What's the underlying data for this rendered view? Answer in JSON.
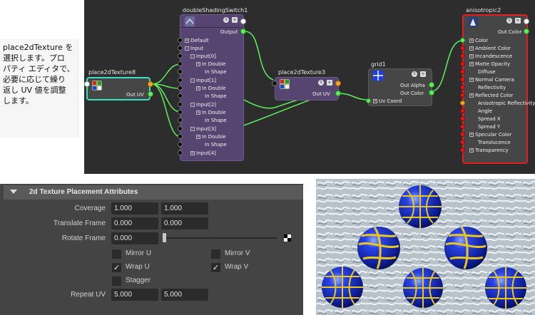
{
  "caption": {
    "text": "place2dTexture を\n選択します。プロ\nパティ エディタで、\n必要に応じて繰り\n返し UV 値を調整\nします。"
  },
  "nodes": {
    "place_a": {
      "title": "place2dTexture8",
      "out_label": "Out UV"
    },
    "switch": {
      "title": "doubleShadingSwitch1",
      "output_label": "Output",
      "rows": [
        "Default",
        "Input",
        "Input[0]",
        "In Double",
        "In Shape",
        "Input[1]",
        "In Double",
        "In Shape",
        "Input[2]",
        "In Double",
        "In Shape",
        "Input[3]",
        "In Double",
        "In Shape",
        "Input[4]"
      ]
    },
    "place_b": {
      "title": "place2dTexture3",
      "out_label": "Out UV"
    },
    "grid": {
      "title": "grid1",
      "rows": [
        "Out Alpha",
        "Out Color",
        "Uv Coord"
      ]
    },
    "aniso": {
      "title": "anisotropic2",
      "out_label": "Out Color",
      "rows": [
        "Color",
        "Ambient Color",
        "Incandescence",
        "Matte Opacity",
        "Diffuse",
        "Normal Camera",
        "Reflectivity",
        "Reflected Color",
        "Anisotropic Reflectivity",
        "Angle",
        "Spread X",
        "Spread Y",
        "Specular Color",
        "Translucence",
        "Transparency"
      ]
    }
  },
  "attr_panel": {
    "header": "2d Texture Placement Attributes",
    "coverage": {
      "label": "Coverage",
      "u": "1.000",
      "v": "1.000"
    },
    "translate_frame": {
      "label": "Translate Frame",
      "u": "0.000",
      "v": "0.000"
    },
    "rotate_frame": {
      "label": "Rotate Frame",
      "value": "0.000",
      "slider_level": 0
    },
    "mirror_u": {
      "label": "Mirror U",
      "checked": false
    },
    "mirror_v": {
      "label": "Mirror V",
      "checked": false
    },
    "wrap_u": {
      "label": "Wrap U",
      "checked": true
    },
    "wrap_v": {
      "label": "Wrap V",
      "checked": true
    },
    "stagger": {
      "label": "Stagger",
      "checked": false
    },
    "repeat_uv": {
      "label": "Repeat UV",
      "u": "5.000",
      "v": "5.000"
    },
    "check_glyph": "✓"
  },
  "colors": {
    "selection_cyan": "#39e1c2",
    "selection_red": "#e02020",
    "wire_green": "#5df05d",
    "sphere_blue": "#1530c8",
    "grid_yellow": "#e8c820"
  }
}
